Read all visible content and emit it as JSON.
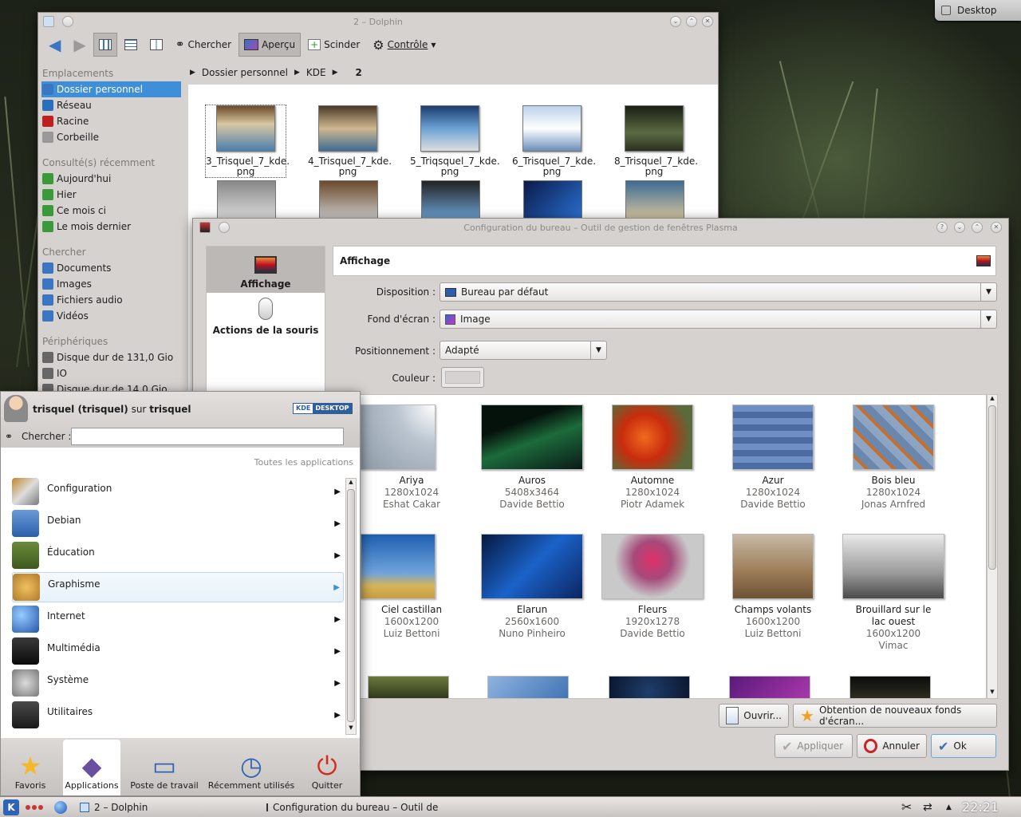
{
  "desktop": {
    "button_label": "Desktop"
  },
  "dolphin": {
    "title": "2 – Dolphin",
    "toolbar": {
      "search": "Chercher",
      "preview": "Aperçu",
      "split": "Scinder",
      "control": "Contrôle"
    },
    "sidebar": {
      "places_header": "Emplacements",
      "places": [
        "Dossier personnel",
        "Réseau",
        "Racine",
        "Corbeille"
      ],
      "recent_header": "Consulté(s) récemment",
      "recent": [
        "Aujourd'hui",
        "Hier",
        "Ce mois ci",
        "Le mois dernier"
      ],
      "search_header": "Chercher",
      "search": [
        "Documents",
        "Images",
        "Fichiers audio",
        "Vidéos"
      ],
      "devices_header": "Périphériques",
      "devices": [
        "Disque dur de 131,0 Gio",
        "IO",
        "Disque dur de 14,0 Gio"
      ]
    },
    "breadcrumb": [
      "Dossier personnel",
      "KDE",
      "2"
    ],
    "files": [
      {
        "line1": "3_Trisquel_7_kde.",
        "line2": "png"
      },
      {
        "line1": "4_Trisquel_7_kde.",
        "line2": "png"
      },
      {
        "line1": "5_Triqsquel_7_kde.",
        "line2": "png"
      },
      {
        "line1": "6_Trisquel_7_kde.",
        "line2": "png"
      },
      {
        "line1": "8_Trisquel_7_kde.",
        "line2": "png"
      }
    ]
  },
  "config": {
    "title": "Configuration du bureau – Outil de gestion de fenêtres Plasma",
    "sections": [
      "Affichage",
      "Actions de la souris"
    ],
    "header": "Affichage",
    "labels": {
      "layout": "Disposition :",
      "wallpaper": "Fond d'écran :",
      "position": "Positionnement :",
      "color": "Couleur :"
    },
    "values": {
      "layout": "Bureau par défaut",
      "wallpaper": "Image",
      "position": "Adapté"
    },
    "wallpapers": [
      {
        "name": "Ariya",
        "size": "1280x1024",
        "author": "Eshat Cakar"
      },
      {
        "name": "Auros",
        "size": "5408x3464",
        "author": "Davide Bettio"
      },
      {
        "name": "Automne",
        "size": "1280x1024",
        "author": "Piotr Adamek"
      },
      {
        "name": "Azur",
        "size": "1280x1024",
        "author": "Davide Bettio"
      },
      {
        "name": "Bois bleu",
        "size": "1280x1024",
        "author": "Jonas Arnfred"
      },
      {
        "name": "Ciel castillan",
        "size": "1600x1200",
        "author": "Luiz Bettoni"
      },
      {
        "name": "Elarun",
        "size": "2560x1600",
        "author": "Nuno Pinheiro"
      },
      {
        "name": "Fleurs",
        "size": "1920x1278",
        "author": "Davide Bettio"
      },
      {
        "name": "Champs volants",
        "size": "1600x1200",
        "author": "Luiz Bettoni"
      },
      {
        "name": "Brouillard sur le lac ouest",
        "size": "1600x1200",
        "author": "Vimac"
      }
    ],
    "buttons": {
      "open": "Ouvrir...",
      "get_new": "Obtention de nouveaux fonds d'écran...",
      "apply": "Appliquer",
      "cancel": "Annuler",
      "ok": "Ok"
    }
  },
  "kickoff": {
    "user": "trisquel (trisquel)",
    "on": "sur",
    "host": "trisquel",
    "badge_left": "KDE",
    "badge_right": "DESKTOP",
    "search_label": "Chercher :",
    "search_value": "",
    "all_apps": "Toutes les applications",
    "categories": [
      "Configuration",
      "Debian",
      "Éducation",
      "Graphisme",
      "Internet",
      "Multimédia",
      "Système",
      "Utilitaires"
    ],
    "tabs": [
      "Favoris",
      "Applications",
      "Poste de travail",
      "Récemment utilisés",
      "Quitter"
    ]
  },
  "taskbar": {
    "tasks": [
      "2 – Dolphin",
      "Configuration du bureau – Outil de ge"
    ],
    "clock": "22:21"
  }
}
